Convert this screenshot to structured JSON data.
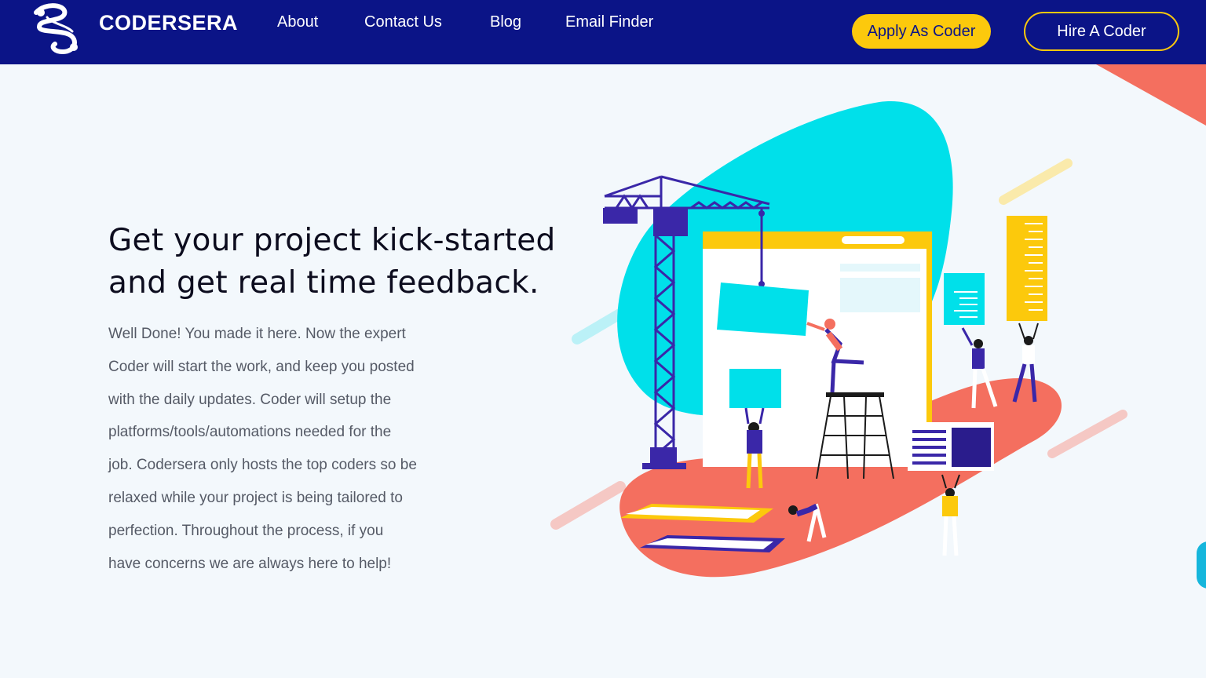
{
  "header": {
    "brand": "CODERSERA",
    "nav": [
      {
        "label": "About"
      },
      {
        "label": "Contact Us"
      },
      {
        "label": "Blog"
      },
      {
        "label": "Email Finder"
      }
    ],
    "apply_label": "Apply As Coder",
    "hire_label": "Hire A Coder"
  },
  "hero": {
    "title_line1": "Get your project kick-started",
    "title_line2": "and get real time feedback.",
    "body_lines": [
      "Well Done! You made it here. Now the expert",
      "Coder will start the work, and keep you posted",
      "with the daily updates. Coder will setup the",
      "platforms/tools/automations needed for the",
      "job. Codersera only hosts the top coders so be",
      "relaxed while your project is being tailored to",
      "perfection. Throughout the process, if you",
      "have concerns we are always here to help!"
    ]
  },
  "colors": {
    "nav_bg": "#0b1487",
    "accent_yellow": "#fcc90c",
    "cyan_blob": "#00e0ea",
    "coral": "#f46f5f",
    "page_bg": "#f3f8fc"
  },
  "icons": {
    "logo": "codersera-logo-icon",
    "illustration": "construction-crane-illustration"
  }
}
